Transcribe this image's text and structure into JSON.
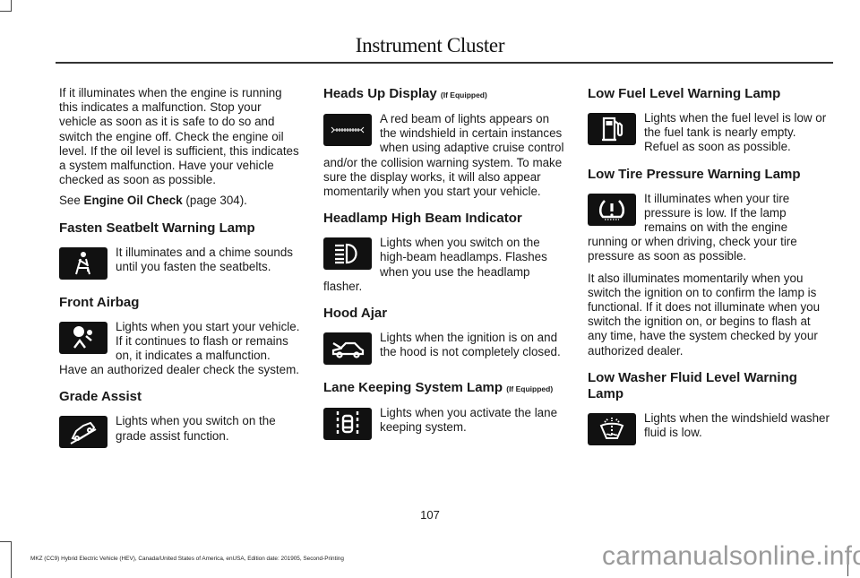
{
  "header": {
    "title": "Instrument Cluster"
  },
  "column1": {
    "intro_paragraph": "If it illuminates when the engine is running this indicates a malfunction.  Stop your vehicle as soon as it is safe to do so and switch the engine off.  Check the engine oil level.  If the oil level is sufficient, this indicates a system malfunction.  Have your vehicle checked as soon as possible.",
    "see_prefix": "See ",
    "see_link": "Engine Oil Check",
    "see_suffix": " (page 304).",
    "sections": [
      {
        "title": "Fasten Seatbelt Warning Lamp",
        "icon": "seatbelt-icon",
        "text": "It illuminates and a chime sounds until you fasten the seatbelts."
      },
      {
        "title": "Front Airbag",
        "icon": "airbag-icon",
        "text": "Lights when you start your vehicle. If it continues to flash or remains on, it indicates a malfunction. Have an authorized dealer check the system."
      },
      {
        "title": "Grade Assist",
        "icon": "grade-assist-icon",
        "text": "Lights when you switch on the grade assist function."
      }
    ]
  },
  "column2": {
    "sections": [
      {
        "title": "Heads Up Display",
        "qualifier": "(If Equipped)",
        "icon": "heads-up-display-icon",
        "text": "A red beam of lights appears on the windshield in certain instances when using adaptive cruise control and/or the collision warning system. To make sure the display works, it will also appear momentarily when you start your vehicle."
      },
      {
        "title": "Headlamp High Beam Indicator",
        "icon": "high-beam-icon",
        "text": "Lights when you switch on the high-beam headlamps. Flashes when you use the headlamp flasher."
      },
      {
        "title": "Hood Ajar",
        "icon": "hood-ajar-icon",
        "text": "Lights when the ignition is on and the hood is not completely closed."
      },
      {
        "title": "Lane Keeping System Lamp",
        "qualifier": "(If Equipped)",
        "icon": "lane-keeping-icon",
        "text": "Lights when you activate the lane keeping system."
      }
    ]
  },
  "column3": {
    "sections": [
      {
        "title": "Low Fuel Level Warning Lamp",
        "icon": "fuel-pump-icon",
        "text": "Lights when the fuel level is low or the fuel tank is nearly empty. Refuel as soon as possible."
      },
      {
        "title": "Low Tire Pressure Warning Lamp",
        "icon": "tire-pressure-icon",
        "text": "It illuminates when your tire pressure is low. If the lamp remains on with the engine running or when driving, check your tire pressure as soon as possible.",
        "extra_paragraph": "It also illuminates momentarily when you switch the ignition on to confirm the lamp is functional. If it does not illuminate when you switch the ignition on, or begins to flash at any time, have the system checked by your authorized dealer."
      },
      {
        "title": "Low Washer Fluid Level Warning Lamp",
        "icon": "washer-fluid-icon",
        "text": "Lights when the windshield washer fluid is low."
      }
    ]
  },
  "footer": {
    "page_number": "107",
    "edition_text": "MKZ (CC9) Hybrid Electric Vehicle (HEV), Canada/United States of America, enUSA, Edition date: 201905, Second-Printing",
    "watermark": "carmanualsonline.info"
  }
}
